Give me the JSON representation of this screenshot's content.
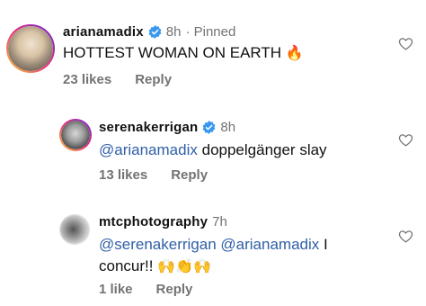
{
  "comments": [
    {
      "username": "arianamadix",
      "time": "8h",
      "pinned": "· Pinned",
      "text_parts": [
        "HOTTEST WOMAN ON EARTH",
        "🔥"
      ],
      "likes": "23 likes",
      "reply": "Reply"
    },
    {
      "username": "serenakerrigan",
      "time": "8h",
      "mention": "@arianamadix",
      "text": "doppelgänger slay",
      "likes": "13 likes",
      "reply": "Reply"
    },
    {
      "username": "mtcphotography",
      "time": "7h",
      "mention1": "@serenakerrigan",
      "mention2": "@arianamadix",
      "text_end": "I",
      "text_line2": "concur!!",
      "emojis": "🙌👏🙌",
      "likes": "1 like",
      "reply": "Reply"
    }
  ],
  "colors": {
    "verified": "#3897f0",
    "mention": "#2f5fa6",
    "muted": "#737373"
  },
  "icons": [
    "verified-badge-icon",
    "heart-outline-icon"
  ]
}
